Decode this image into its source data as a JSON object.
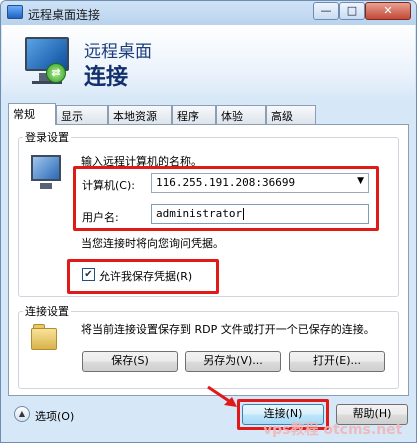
{
  "window": {
    "title": "远程桌面连接",
    "min_glyph": "—",
    "max_glyph": "□",
    "close_glyph": "✕"
  },
  "banner": {
    "subtitle": "远程桌面",
    "headline": "连接"
  },
  "tabs": [
    {
      "label": "常规",
      "active": true
    },
    {
      "label": "显示"
    },
    {
      "label": "本地资源"
    },
    {
      "label": "程序"
    },
    {
      "label": "体验"
    },
    {
      "label": "高级"
    }
  ],
  "login": {
    "group_label": "登录设置",
    "intro": "输入远程计算机的名称。",
    "computer_label": "计算机(C):",
    "computer_value": "116.255.191.208:36699",
    "user_label": "用户名:",
    "user_value": "administrator",
    "credential_note": "当您连接时将向您询问凭据。",
    "save_credentials_label": "允许我保存凭据(R)",
    "save_credentials_checked": true
  },
  "connection": {
    "group_label": "连接设置",
    "description": "将当前连接设置保存到 RDP 文件或打开一个已保存的连接。",
    "save_button": "保存(S)",
    "save_as_button": "另存为(V)...",
    "open_button": "打开(E)..."
  },
  "footer": {
    "options_label": "选项(O)",
    "connect_button": "连接(N)",
    "help_button": "帮助(H)",
    "watermark": "vps教程 otcms.net"
  },
  "colors": {
    "annotation_red": "#e01919",
    "accent_blue": "#12306b"
  },
  "icons": {
    "banner": "remote-desktop-icon",
    "login": "computer-icon",
    "connection": "folder-icon",
    "options": "chevron-up-icon",
    "pointer": "red-arrow-icon"
  }
}
